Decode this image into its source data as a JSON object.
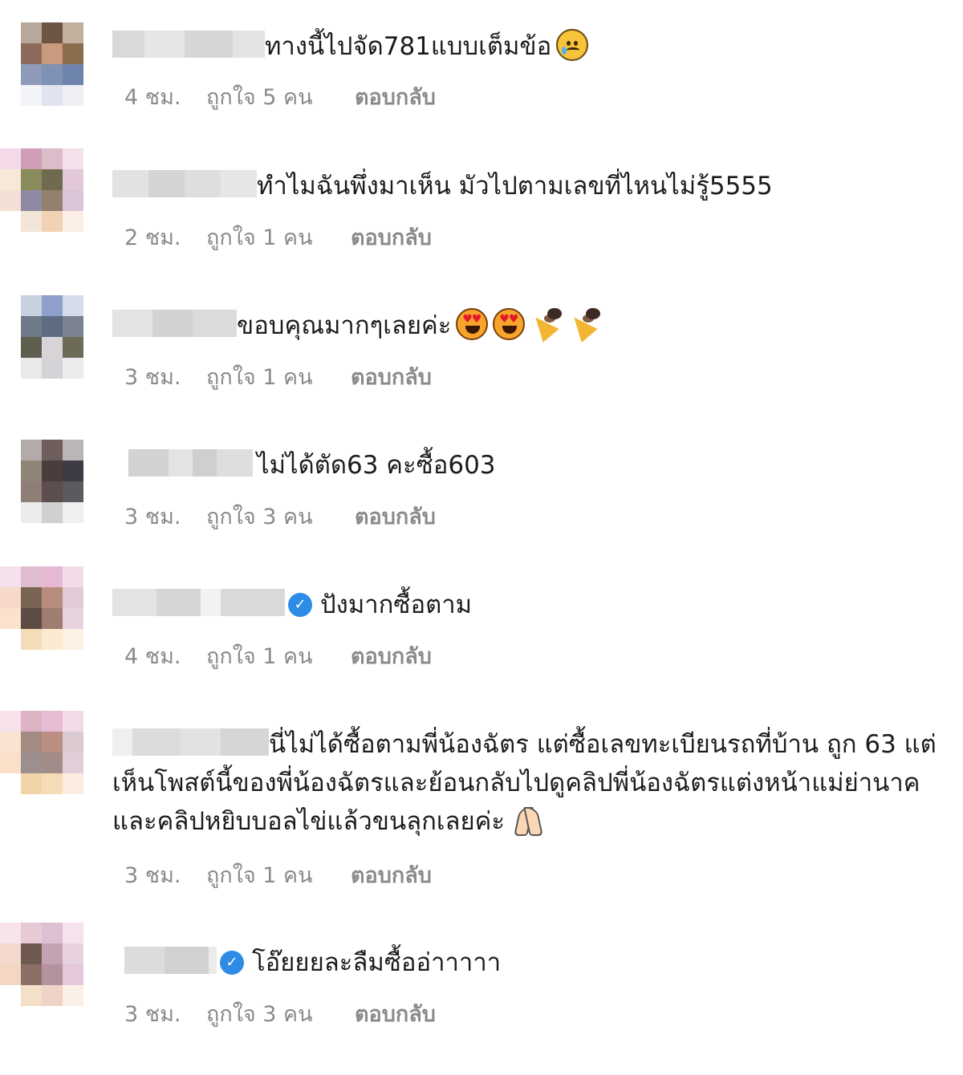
{
  "comments": [
    {
      "text": "ทางนี้ไปจัด781แบบเต็มข้อ",
      "emoji": [
        "crying-face-icon"
      ],
      "time": "4 ชม.",
      "likes": "ถูกใจ 5 คน",
      "reply": "ตอบกลับ",
      "verified": false
    },
    {
      "text": "ทำไมฉันพึ่งมาเห็น มัวไปตามเลขที่ไหนไม่รู้5555",
      "emoji": [],
      "time": "2 ชม.",
      "likes": "ถูกใจ 1 คน",
      "reply": "ตอบกลับ",
      "verified": false
    },
    {
      "text": "ขอบคุณมากๆเลยค่ะ",
      "emoji": [
        "heart-eyes-icon",
        "heart-eyes-icon",
        "party-popper-icon",
        "party-popper-icon"
      ],
      "time": "3 ชม.",
      "likes": "ถูกใจ 1 คน",
      "reply": "ตอบกลับ",
      "verified": false
    },
    {
      "text": "ไม่ได้ตัด63 คะซื้อ603",
      "emoji": [],
      "time": "3 ชม.",
      "likes": "ถูกใจ 3 คน",
      "reply": "ตอบกลับ",
      "verified": false
    },
    {
      "text": "ปังมากซื้อตาม",
      "emoji": [],
      "time": "4 ชม.",
      "likes": "ถูกใจ 1 คน",
      "reply": "ตอบกลับ",
      "verified": true
    },
    {
      "text": "นี่ไม่ได้ซื้อตามพี่น้องฉัตร แต่ซื้อเลขทะเบียนรถที่บ้าน ถูก 63 แต่เห็นโพสต์นี้ของพี่น้องฉัตรและย้อนกลับไปดูคลิปพี่น้องฉัตรแต่งหน้าแม่ย่านาคและคลิปหยิบบอลไข่แล้วขนลุกเลยค่ะ",
      "emoji": [
        "folded-hands-icon"
      ],
      "time": "3 ชม.",
      "likes": "ถูกใจ 1 คน",
      "reply": "ตอบกลับ",
      "verified": false
    },
    {
      "text": "โอ๊ยยยละลืมซื้ออ่าาาาา",
      "emoji": [],
      "time": "3 ชม.",
      "likes": "ถูกใจ 3 คน",
      "reply": "ตอบกลับ",
      "verified": true
    }
  ],
  "colors": {
    "verified_badge": "#2e8ce6",
    "meta_text": "#8a8a8a",
    "comment_text": "#1c1c1c"
  }
}
